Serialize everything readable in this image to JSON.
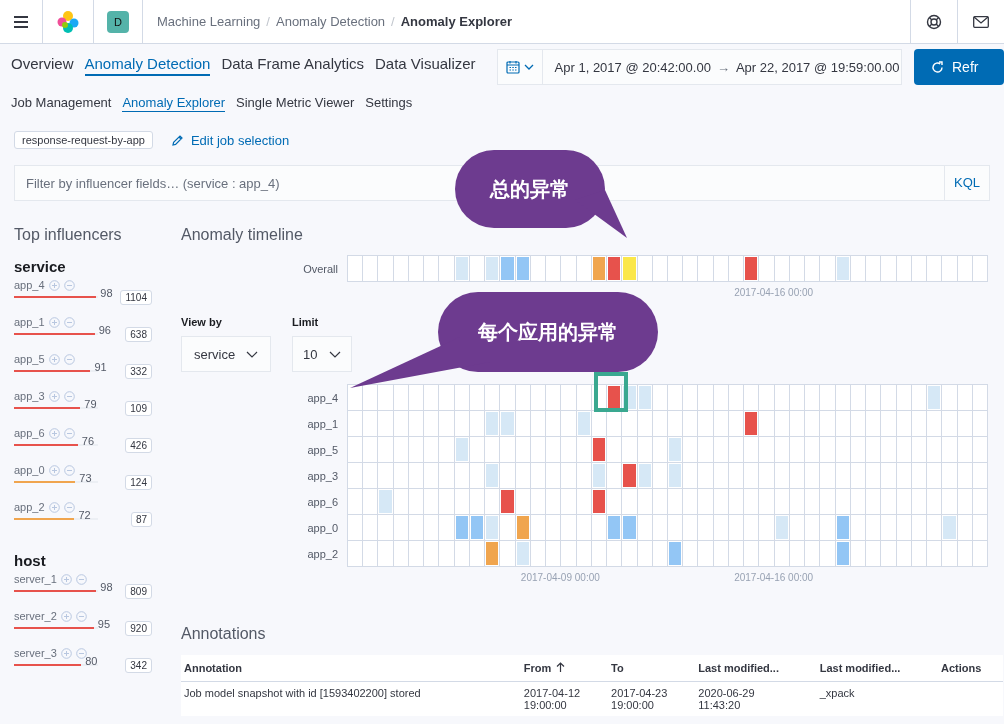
{
  "header": {
    "avatar": "D",
    "breadcrumbs": [
      {
        "label": "Machine Learning",
        "current": false
      },
      {
        "separator": "/",
        "label": "Anomaly Detection",
        "current": false
      },
      {
        "separator": "/",
        "label": "Anomaly Explorer",
        "current": true
      }
    ]
  },
  "nav_tabs": [
    {
      "label": "Overview",
      "selected": false
    },
    {
      "label": "Anomaly Detection",
      "selected": true
    },
    {
      "label": "Data Frame Analytics",
      "selected": false
    },
    {
      "label": "Data Visualizer",
      "selected": false
    }
  ],
  "date_range": {
    "start": "Apr 1, 2017 @ 20:42:00.00",
    "arrow": "→",
    "end": "Apr 22, 2017 @ 19:59:00.00"
  },
  "refresh_button": "Refr",
  "sub_tabs": [
    {
      "label": "Job Management",
      "selected": false
    },
    {
      "label": "Anomaly Explorer",
      "selected": true
    },
    {
      "label": "Single Metric Viewer",
      "selected": false
    },
    {
      "label": "Settings",
      "selected": false
    }
  ],
  "job_badge": "response-request-by-app",
  "edit_job_link": "Edit job selection",
  "filter": {
    "placeholder": "Filter by influencer fields… (service : app_4)",
    "language": "KQL"
  },
  "influencers": {
    "title": "Top influencers",
    "groups": [
      {
        "field": "service",
        "items": [
          {
            "name": "app_4",
            "score": "98",
            "level": 0.98,
            "count": "1104"
          },
          {
            "name": "app_1",
            "score": "96",
            "level": 0.96,
            "count": "638"
          },
          {
            "name": "app_5",
            "score": "91",
            "level": 0.91,
            "count": "332"
          },
          {
            "name": "app_3",
            "score": "79",
            "level": 0.79,
            "count": "109"
          },
          {
            "name": "app_6",
            "score": "76",
            "level": 0.76,
            "count": "426"
          },
          {
            "name": "app_0",
            "score": "73",
            "level": 0.73,
            "count": "124"
          },
          {
            "name": "app_2",
            "score": "72",
            "level": 0.72,
            "count": "87"
          }
        ]
      },
      {
        "field": "host",
        "items": [
          {
            "name": "server_1",
            "score": "98",
            "level": 0.98,
            "count": "809"
          },
          {
            "name": "server_2",
            "score": "95",
            "level": 0.95,
            "count": "920"
          },
          {
            "name": "server_3",
            "score": "80",
            "level": 0.8,
            "count": "342"
          }
        ]
      }
    ]
  },
  "timeline": {
    "title": "Anomaly timeline",
    "overall": {
      "label": "Overall",
      "cells": [
        {
          "color": "#ffffff"
        },
        {
          "color": "#ffffff"
        },
        {
          "color": "#ffffff"
        },
        {
          "color": "#ffffff"
        },
        {
          "color": "#ffffff"
        },
        {
          "color": "#ffffff"
        },
        {
          "color": "#ffffff"
        },
        {
          "color": "#d6e8f6"
        },
        {
          "color": "#ffffff"
        },
        {
          "color": "#d6e8f6"
        },
        {
          "color": "#93c6f5"
        },
        {
          "color": "#93c6f5"
        },
        {
          "color": "#ffffff"
        },
        {
          "color": "#ffffff"
        },
        {
          "color": "#ffffff"
        },
        {
          "color": "#ffffff"
        },
        {
          "color": "#f0a54e"
        },
        {
          "color": "#e7524c"
        },
        {
          "color": "#fbe74a"
        },
        {
          "color": "#ffffff"
        },
        {
          "color": "#ffffff"
        },
        {
          "color": "#ffffff"
        },
        {
          "color": "#ffffff"
        },
        {
          "color": "#ffffff"
        },
        {
          "color": "#ffffff"
        },
        {
          "color": "#ffffff"
        },
        {
          "color": "#e7524c"
        },
        {
          "color": "#ffffff"
        },
        {
          "color": "#ffffff"
        },
        {
          "color": "#ffffff"
        },
        {
          "color": "#ffffff"
        },
        {
          "color": "#ffffff"
        },
        {
          "color": "#d6e8f6"
        },
        {
          "color": "#ffffff"
        },
        {
          "color": "#ffffff"
        },
        {
          "color": "#ffffff"
        },
        {
          "color": "#ffffff"
        },
        {
          "color": "#ffffff"
        },
        {
          "color": "#ffffff"
        },
        {
          "color": "#ffffff"
        },
        {
          "color": "#ffffff"
        },
        {
          "color": "#ffffff"
        }
      ]
    },
    "overall_tick": "2017-04-16 00:00",
    "view_by": {
      "label": "View by",
      "value": "service"
    },
    "limit": {
      "label": "Limit",
      "value": "10"
    },
    "rows": [
      {
        "label": "app_4",
        "cells": [
          {
            "color": "#ffffff"
          },
          {
            "color": "#ffffff"
          },
          {
            "color": "#ffffff"
          },
          {
            "color": "#ffffff"
          },
          {
            "color": "#ffffff"
          },
          {
            "color": "#ffffff"
          },
          {
            "color": "#ffffff"
          },
          {
            "color": "#ffffff"
          },
          {
            "color": "#ffffff"
          },
          {
            "color": "#ffffff"
          },
          {
            "color": "#ffffff"
          },
          {
            "color": "#ffffff"
          },
          {
            "color": "#ffffff"
          },
          {
            "color": "#ffffff"
          },
          {
            "color": "#ffffff"
          },
          {
            "color": "#ffffff"
          },
          {
            "color": "#ffffff"
          },
          {
            "color": "#e7524c"
          },
          {
            "color": "#d6e8f6"
          },
          {
            "color": "#d6e8f6"
          },
          {
            "color": "#ffffff"
          },
          {
            "color": "#ffffff"
          },
          {
            "color": "#ffffff"
          },
          {
            "color": "#ffffff"
          },
          {
            "color": "#ffffff"
          },
          {
            "color": "#ffffff"
          },
          {
            "color": "#ffffff"
          },
          {
            "color": "#ffffff"
          },
          {
            "color": "#ffffff"
          },
          {
            "color": "#ffffff"
          },
          {
            "color": "#ffffff"
          },
          {
            "color": "#ffffff"
          },
          {
            "color": "#ffffff"
          },
          {
            "color": "#ffffff"
          },
          {
            "color": "#ffffff"
          },
          {
            "color": "#ffffff"
          },
          {
            "color": "#ffffff"
          },
          {
            "color": "#ffffff"
          },
          {
            "color": "#d6e8f6"
          },
          {
            "color": "#ffffff"
          },
          {
            "color": "#ffffff"
          },
          {
            "color": "#ffffff"
          }
        ]
      },
      {
        "label": "app_1",
        "cells": [
          {
            "color": "#ffffff"
          },
          {
            "color": "#ffffff"
          },
          {
            "color": "#ffffff"
          },
          {
            "color": "#ffffff"
          },
          {
            "color": "#ffffff"
          },
          {
            "color": "#ffffff"
          },
          {
            "color": "#ffffff"
          },
          {
            "color": "#ffffff"
          },
          {
            "color": "#ffffff"
          },
          {
            "color": "#d6e8f6"
          },
          {
            "color": "#d6e8f6"
          },
          {
            "color": "#ffffff"
          },
          {
            "color": "#ffffff"
          },
          {
            "color": "#ffffff"
          },
          {
            "color": "#ffffff"
          },
          {
            "color": "#d6e8f6"
          },
          {
            "color": "#ffffff"
          },
          {
            "color": "#ffffff"
          },
          {
            "color": "#ffffff"
          },
          {
            "color": "#ffffff"
          },
          {
            "color": "#ffffff"
          },
          {
            "color": "#ffffff"
          },
          {
            "color": "#ffffff"
          },
          {
            "color": "#ffffff"
          },
          {
            "color": "#ffffff"
          },
          {
            "color": "#ffffff"
          },
          {
            "color": "#e7524c"
          },
          {
            "color": "#ffffff"
          },
          {
            "color": "#ffffff"
          },
          {
            "color": "#ffffff"
          },
          {
            "color": "#ffffff"
          },
          {
            "color": "#ffffff"
          },
          {
            "color": "#ffffff"
          },
          {
            "color": "#ffffff"
          },
          {
            "color": "#ffffff"
          },
          {
            "color": "#ffffff"
          },
          {
            "color": "#ffffff"
          },
          {
            "color": "#ffffff"
          },
          {
            "color": "#ffffff"
          },
          {
            "color": "#ffffff"
          },
          {
            "color": "#ffffff"
          },
          {
            "color": "#ffffff"
          }
        ]
      },
      {
        "label": "app_5",
        "cells": [
          {
            "color": "#ffffff"
          },
          {
            "color": "#ffffff"
          },
          {
            "color": "#ffffff"
          },
          {
            "color": "#ffffff"
          },
          {
            "color": "#ffffff"
          },
          {
            "color": "#ffffff"
          },
          {
            "color": "#ffffff"
          },
          {
            "color": "#d6e8f6"
          },
          {
            "color": "#ffffff"
          },
          {
            "color": "#ffffff"
          },
          {
            "color": "#ffffff"
          },
          {
            "color": "#ffffff"
          },
          {
            "color": "#ffffff"
          },
          {
            "color": "#ffffff"
          },
          {
            "color": "#ffffff"
          },
          {
            "color": "#ffffff"
          },
          {
            "color": "#e7524c"
          },
          {
            "color": "#ffffff"
          },
          {
            "color": "#ffffff"
          },
          {
            "color": "#ffffff"
          },
          {
            "color": "#ffffff"
          },
          {
            "color": "#d6e8f6"
          },
          {
            "color": "#ffffff"
          },
          {
            "color": "#ffffff"
          },
          {
            "color": "#ffffff"
          },
          {
            "color": "#ffffff"
          },
          {
            "color": "#ffffff"
          },
          {
            "color": "#ffffff"
          },
          {
            "color": "#ffffff"
          },
          {
            "color": "#ffffff"
          },
          {
            "color": "#ffffff"
          },
          {
            "color": "#ffffff"
          },
          {
            "color": "#ffffff"
          },
          {
            "color": "#ffffff"
          },
          {
            "color": "#ffffff"
          },
          {
            "color": "#ffffff"
          },
          {
            "color": "#ffffff"
          },
          {
            "color": "#ffffff"
          },
          {
            "color": "#ffffff"
          },
          {
            "color": "#ffffff"
          },
          {
            "color": "#ffffff"
          },
          {
            "color": "#ffffff"
          }
        ]
      },
      {
        "label": "app_3",
        "cells": [
          {
            "color": "#ffffff"
          },
          {
            "color": "#ffffff"
          },
          {
            "color": "#ffffff"
          },
          {
            "color": "#ffffff"
          },
          {
            "color": "#ffffff"
          },
          {
            "color": "#ffffff"
          },
          {
            "color": "#ffffff"
          },
          {
            "color": "#ffffff"
          },
          {
            "color": "#ffffff"
          },
          {
            "color": "#d6e8f6"
          },
          {
            "color": "#ffffff"
          },
          {
            "color": "#ffffff"
          },
          {
            "color": "#ffffff"
          },
          {
            "color": "#ffffff"
          },
          {
            "color": "#ffffff"
          },
          {
            "color": "#ffffff"
          },
          {
            "color": "#d6e8f6"
          },
          {
            "color": "#ffffff"
          },
          {
            "color": "#e7524c"
          },
          {
            "color": "#d6e8f6"
          },
          {
            "color": "#ffffff"
          },
          {
            "color": "#d6e8f6"
          },
          {
            "color": "#ffffff"
          },
          {
            "color": "#ffffff"
          },
          {
            "color": "#ffffff"
          },
          {
            "color": "#ffffff"
          },
          {
            "color": "#ffffff"
          },
          {
            "color": "#ffffff"
          },
          {
            "color": "#ffffff"
          },
          {
            "color": "#ffffff"
          },
          {
            "color": "#ffffff"
          },
          {
            "color": "#ffffff"
          },
          {
            "color": "#ffffff"
          },
          {
            "color": "#ffffff"
          },
          {
            "color": "#ffffff"
          },
          {
            "color": "#ffffff"
          },
          {
            "color": "#ffffff"
          },
          {
            "color": "#ffffff"
          },
          {
            "color": "#ffffff"
          },
          {
            "color": "#ffffff"
          },
          {
            "color": "#ffffff"
          },
          {
            "color": "#ffffff"
          }
        ]
      },
      {
        "label": "app_6",
        "cells": [
          {
            "color": "#ffffff"
          },
          {
            "color": "#ffffff"
          },
          {
            "color": "#d6e8f6"
          },
          {
            "color": "#ffffff"
          },
          {
            "color": "#ffffff"
          },
          {
            "color": "#ffffff"
          },
          {
            "color": "#ffffff"
          },
          {
            "color": "#ffffff"
          },
          {
            "color": "#ffffff"
          },
          {
            "color": "#ffffff"
          },
          {
            "color": "#e7524c"
          },
          {
            "color": "#ffffff"
          },
          {
            "color": "#ffffff"
          },
          {
            "color": "#ffffff"
          },
          {
            "color": "#ffffff"
          },
          {
            "color": "#ffffff"
          },
          {
            "color": "#e7524c"
          },
          {
            "color": "#ffffff"
          },
          {
            "color": "#ffffff"
          },
          {
            "color": "#ffffff"
          },
          {
            "color": "#ffffff"
          },
          {
            "color": "#ffffff"
          },
          {
            "color": "#ffffff"
          },
          {
            "color": "#ffffff"
          },
          {
            "color": "#ffffff"
          },
          {
            "color": "#ffffff"
          },
          {
            "color": "#ffffff"
          },
          {
            "color": "#ffffff"
          },
          {
            "color": "#ffffff"
          },
          {
            "color": "#ffffff"
          },
          {
            "color": "#ffffff"
          },
          {
            "color": "#ffffff"
          },
          {
            "color": "#ffffff"
          },
          {
            "color": "#ffffff"
          },
          {
            "color": "#ffffff"
          },
          {
            "color": "#ffffff"
          },
          {
            "color": "#ffffff"
          },
          {
            "color": "#ffffff"
          },
          {
            "color": "#ffffff"
          },
          {
            "color": "#ffffff"
          },
          {
            "color": "#ffffff"
          },
          {
            "color": "#ffffff"
          }
        ]
      },
      {
        "label": "app_0",
        "cells": [
          {
            "color": "#ffffff"
          },
          {
            "color": "#ffffff"
          },
          {
            "color": "#ffffff"
          },
          {
            "color": "#ffffff"
          },
          {
            "color": "#ffffff"
          },
          {
            "color": "#ffffff"
          },
          {
            "color": "#ffffff"
          },
          {
            "color": "#93c6f5"
          },
          {
            "color": "#93c6f5"
          },
          {
            "color": "#d6e8f6"
          },
          {
            "color": "#ffffff"
          },
          {
            "color": "#f0a54e"
          },
          {
            "color": "#ffffff"
          },
          {
            "color": "#ffffff"
          },
          {
            "color": "#ffffff"
          },
          {
            "color": "#ffffff"
          },
          {
            "color": "#ffffff"
          },
          {
            "color": "#93c6f5"
          },
          {
            "color": "#93c6f5"
          },
          {
            "color": "#ffffff"
          },
          {
            "color": "#ffffff"
          },
          {
            "color": "#ffffff"
          },
          {
            "color": "#ffffff"
          },
          {
            "color": "#ffffff"
          },
          {
            "color": "#ffffff"
          },
          {
            "color": "#ffffff"
          },
          {
            "color": "#ffffff"
          },
          {
            "color": "#ffffff"
          },
          {
            "color": "#d6e8f6"
          },
          {
            "color": "#ffffff"
          },
          {
            "color": "#ffffff"
          },
          {
            "color": "#ffffff"
          },
          {
            "color": "#93c6f5"
          },
          {
            "color": "#ffffff"
          },
          {
            "color": "#ffffff"
          },
          {
            "color": "#ffffff"
          },
          {
            "color": "#ffffff"
          },
          {
            "color": "#ffffff"
          },
          {
            "color": "#ffffff"
          },
          {
            "color": "#d6e8f6"
          },
          {
            "color": "#ffffff"
          },
          {
            "color": "#ffffff"
          }
        ]
      },
      {
        "label": "app_2",
        "cells": [
          {
            "color": "#ffffff"
          },
          {
            "color": "#ffffff"
          },
          {
            "color": "#ffffff"
          },
          {
            "color": "#ffffff"
          },
          {
            "color": "#ffffff"
          },
          {
            "color": "#ffffff"
          },
          {
            "color": "#ffffff"
          },
          {
            "color": "#ffffff"
          },
          {
            "color": "#ffffff"
          },
          {
            "color": "#f0a54e"
          },
          {
            "color": "#ffffff"
          },
          {
            "color": "#d6e8f6"
          },
          {
            "color": "#ffffff"
          },
          {
            "color": "#ffffff"
          },
          {
            "color": "#ffffff"
          },
          {
            "color": "#ffffff"
          },
          {
            "color": "#ffffff"
          },
          {
            "color": "#ffffff"
          },
          {
            "color": "#ffffff"
          },
          {
            "color": "#ffffff"
          },
          {
            "color": "#ffffff"
          },
          {
            "color": "#93c6f5"
          },
          {
            "color": "#ffffff"
          },
          {
            "color": "#ffffff"
          },
          {
            "color": "#ffffff"
          },
          {
            "color": "#ffffff"
          },
          {
            "color": "#ffffff"
          },
          {
            "color": "#ffffff"
          },
          {
            "color": "#ffffff"
          },
          {
            "color": "#ffffff"
          },
          {
            "color": "#ffffff"
          },
          {
            "color": "#ffffff"
          },
          {
            "color": "#93c6f5"
          },
          {
            "color": "#ffffff"
          },
          {
            "color": "#ffffff"
          },
          {
            "color": "#ffffff"
          },
          {
            "color": "#ffffff"
          },
          {
            "color": "#ffffff"
          },
          {
            "color": "#ffffff"
          },
          {
            "color": "#ffffff"
          },
          {
            "color": "#ffffff"
          },
          {
            "color": "#ffffff"
          }
        ]
      }
    ],
    "ticks": [
      "2017-04-09 00:00",
      "2017-04-16 00:00"
    ]
  },
  "callouts": [
    {
      "text": "总的异常"
    },
    {
      "text": "每个应用的异常"
    }
  ],
  "annotations": {
    "title": "Annotations",
    "columns": [
      {
        "label": "Annotation",
        "sorted": false
      },
      {
        "label": "From",
        "sorted": true
      },
      {
        "label": "To",
        "sorted": false
      },
      {
        "label": "Last modified...",
        "sorted": false
      },
      {
        "label": "Last modified...",
        "sorted": false
      },
      {
        "label": "Actions",
        "sorted": false
      }
    ],
    "rows": [
      {
        "annotation": "Job model snapshot with id [1593402200] stored",
        "from": "2017-04-12\n19:00:00",
        "to": "2017-04-23\n19:00:00",
        "modified": "2020-06-29\n11:43:20",
        "modified_by": "_xpack"
      }
    ]
  }
}
